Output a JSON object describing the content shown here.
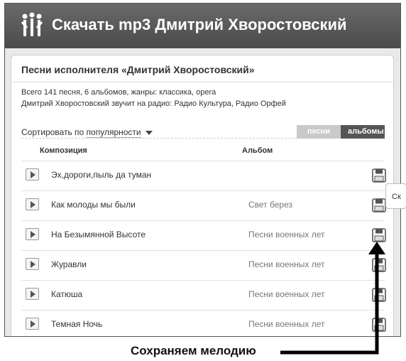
{
  "header": {
    "title": "Скачать mp3 Дмитрий Хворостовский"
  },
  "panel": {
    "title": "Песни исполнителя «Дмитрий Хворостовский»",
    "info_line1": "Всего 141 песня, 6 альбомов, жанры: классика, opera",
    "info_line2": "Дмитрий Хворостовский звучит на радио: Радио Культура, Радио Орфей"
  },
  "sort": {
    "prefix": "Сортировать по",
    "value": "популярности"
  },
  "tabs": {
    "songs": "песни",
    "albums": "альбомы"
  },
  "columns": {
    "composition": "Композиция",
    "album": "Альбом"
  },
  "tracks": [
    {
      "title": "Эх,дороги,пыль да туман",
      "album": ""
    },
    {
      "title": "Как молоды мы были",
      "album": "Свет берез"
    },
    {
      "title": "На Безымянной Высоте",
      "album": "Песни военных лет"
    },
    {
      "title": "Журавли",
      "album": "Песни военных лет"
    },
    {
      "title": "Катюша",
      "album": "Песни военных лет"
    },
    {
      "title": "Темная Ночь",
      "album": "Песни военных лет"
    }
  ],
  "tooltip": {
    "text": "Ск"
  },
  "annotation": {
    "caption": "Сохраняем мелодию"
  },
  "icons": {
    "logo": "people-logo-icon",
    "play": "play-icon",
    "save": "floppy-disk-icon",
    "caret": "chevron-down-icon"
  }
}
